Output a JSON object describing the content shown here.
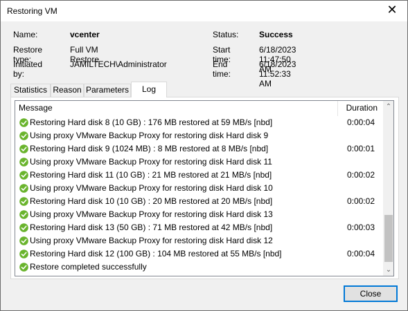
{
  "window": {
    "title": "Restoring VM",
    "close_glyph": "✕"
  },
  "info": {
    "name_label": "Name:",
    "name_value": "vcenter",
    "restore_type_label": "Restore type:",
    "restore_type_value": "Full VM Restore",
    "initiated_by_label": "Initiated by:",
    "initiated_by_value": "JAMILTECH\\Administrator",
    "status_label": "Status:",
    "status_value": "Success",
    "start_time_label": "Start time:",
    "start_time_value": "6/18/2023 11:47:50 AM",
    "end_time_label": "End time:",
    "end_time_value": "6/18/2023 11:52:33 AM"
  },
  "tabs": [
    {
      "label": "Statistics",
      "active": false
    },
    {
      "label": "Reason",
      "active": false
    },
    {
      "label": "Parameters",
      "active": false
    },
    {
      "label": "Log",
      "active": true
    }
  ],
  "log": {
    "columns": {
      "message": "Message",
      "duration": "Duration"
    },
    "status_icon": "check-circle-icon",
    "status_color": "#6ab42d",
    "rows": [
      {
        "message": "Restoring Hard disk 8 (10 GB) : 176 MB restored at 59 MB/s  [nbd]",
        "duration": "0:00:04"
      },
      {
        "message": "Using proxy VMware Backup Proxy for restoring disk Hard disk 9",
        "duration": ""
      },
      {
        "message": "Restoring Hard disk 9 (1024 MB) : 8 MB restored at 8 MB/s  [nbd]",
        "duration": "0:00:01"
      },
      {
        "message": "Using proxy VMware Backup Proxy for restoring disk Hard disk 11",
        "duration": ""
      },
      {
        "message": "Restoring Hard disk 11 (10 GB) : 21 MB restored at 21 MB/s  [nbd]",
        "duration": "0:00:02"
      },
      {
        "message": "Using proxy VMware Backup Proxy for restoring disk Hard disk 10",
        "duration": ""
      },
      {
        "message": "Restoring Hard disk 10 (10 GB) : 20 MB restored at 20 MB/s  [nbd]",
        "duration": "0:00:02"
      },
      {
        "message": "Using proxy VMware Backup Proxy for restoring disk Hard disk 13",
        "duration": ""
      },
      {
        "message": "Restoring Hard disk 13 (50 GB) : 71 MB restored at 42 MB/s  [nbd]",
        "duration": "0:00:03"
      },
      {
        "message": "Using proxy VMware Backup Proxy for restoring disk Hard disk 12",
        "duration": ""
      },
      {
        "message": "Restoring Hard disk 12 (100 GB) : 104 MB restored at 55 MB/s  [nbd]",
        "duration": "0:00:04"
      },
      {
        "message": "Restore completed successfully",
        "duration": ""
      }
    ]
  },
  "buttons": {
    "close_label": "Close"
  }
}
